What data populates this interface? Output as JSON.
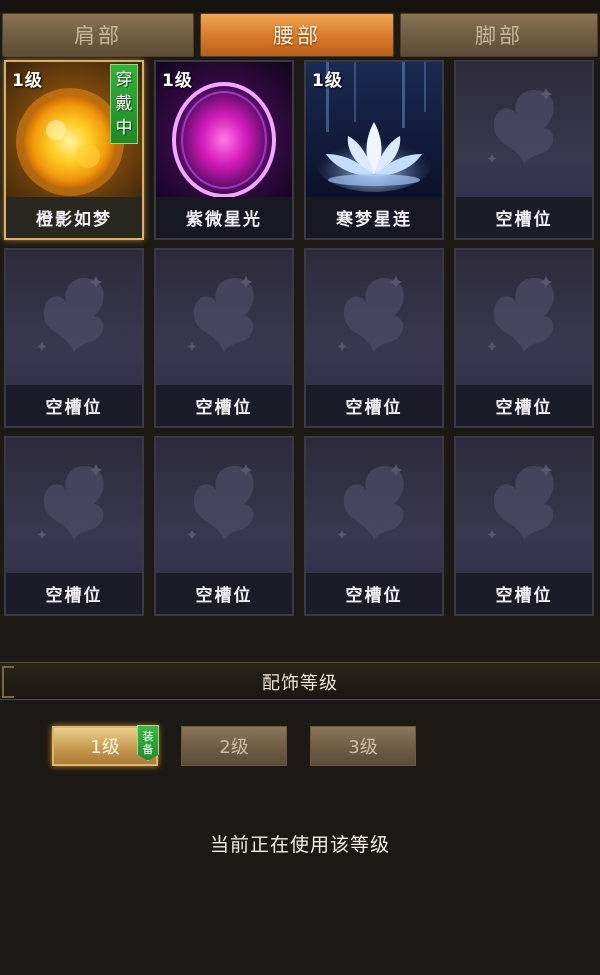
{
  "tabs": [
    {
      "label": "肩部",
      "active": false
    },
    {
      "label": "腰部",
      "active": true
    },
    {
      "label": "脚部",
      "active": false
    }
  ],
  "slots": [
    {
      "name": "橙影如梦",
      "level": "1级",
      "art": "sun",
      "worn": true,
      "wear_label_1": "穿",
      "wear_label_2": "戴",
      "wear_label_3": "中"
    },
    {
      "name": "紫微星光",
      "level": "1级",
      "art": "purple-orb"
    },
    {
      "name": "寒梦星连",
      "level": "1级",
      "art": "lotus"
    },
    {
      "name": "空槽位",
      "art": "butterfly"
    },
    {
      "name": "空槽位",
      "art": "butterfly"
    },
    {
      "name": "空槽位",
      "art": "butterfly"
    },
    {
      "name": "空槽位",
      "art": "butterfly"
    },
    {
      "name": "空槽位",
      "art": "butterfly"
    },
    {
      "name": "空槽位",
      "art": "butterfly"
    },
    {
      "name": "空槽位",
      "art": "butterfly"
    },
    {
      "name": "空槽位",
      "art": "butterfly"
    },
    {
      "name": "空槽位",
      "art": "butterfly"
    }
  ],
  "section": {
    "title": "配饰等级"
  },
  "levels": [
    {
      "label": "1级",
      "active": true
    },
    {
      "label": "2级",
      "active": false
    },
    {
      "label": "3级",
      "active": false
    }
  ],
  "equip_tag": {
    "line1": "装",
    "line2": "备"
  },
  "status": "当前正在使用该等级",
  "colors": {
    "active_tab": "#d87a2a",
    "worn_badge": "#1f8a27",
    "selected_border": "#d9b26a"
  }
}
